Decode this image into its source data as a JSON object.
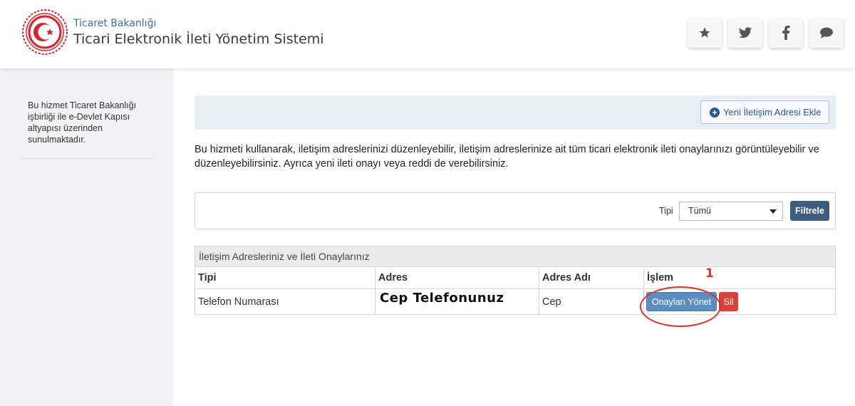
{
  "header": {
    "ministry": "Ticaret Bakanlığı",
    "system_title": "Ticari Elektronik İleti Yönetim Sistemi",
    "icons": [
      "star-icon",
      "twitter-icon",
      "facebook-icon",
      "chat-icon"
    ]
  },
  "sidebar": {
    "text": "Bu hizmet Ticaret Bakanlığı işbirliği ile e-Devlet Kapısı altyapısı üzerinden sunulmaktadır."
  },
  "toolbar": {
    "new_address_label": "Yeni İletişim Adresi Ekle"
  },
  "description": "Bu hizmeti kullanarak, iletişim adreslerinizi düzenleyebilir, iletişim adreslerinize ait tüm ticari elektronik ileti onaylarınızı görüntüleyebilir ve düzenleyebilirsiniz. Ayrıca yeni ileti onayı veya reddi de verebilirsiniz.",
  "filter": {
    "type_label": "Tipi",
    "selected": "Tümü",
    "button_label": "Filtrele"
  },
  "table": {
    "title": "İletişim Adresleriniz ve İleti Onaylarınız",
    "columns": [
      "Tipi",
      "Adres",
      "Adres Adı",
      "İşlem"
    ],
    "rows": [
      {
        "type": "Telefon Numarası",
        "address": "Cep Telefonunuz",
        "address_name": "Cep",
        "manage_label": "Onayları Yönet",
        "delete_label": "Sil"
      }
    ]
  },
  "annotation": {
    "number": "1",
    "color": "#e0321e"
  },
  "colors": {
    "primary_dark": "#3d5c7e",
    "primary": "#5b8cc2",
    "danger": "#d9403a",
    "link": "#3b6fb1"
  }
}
